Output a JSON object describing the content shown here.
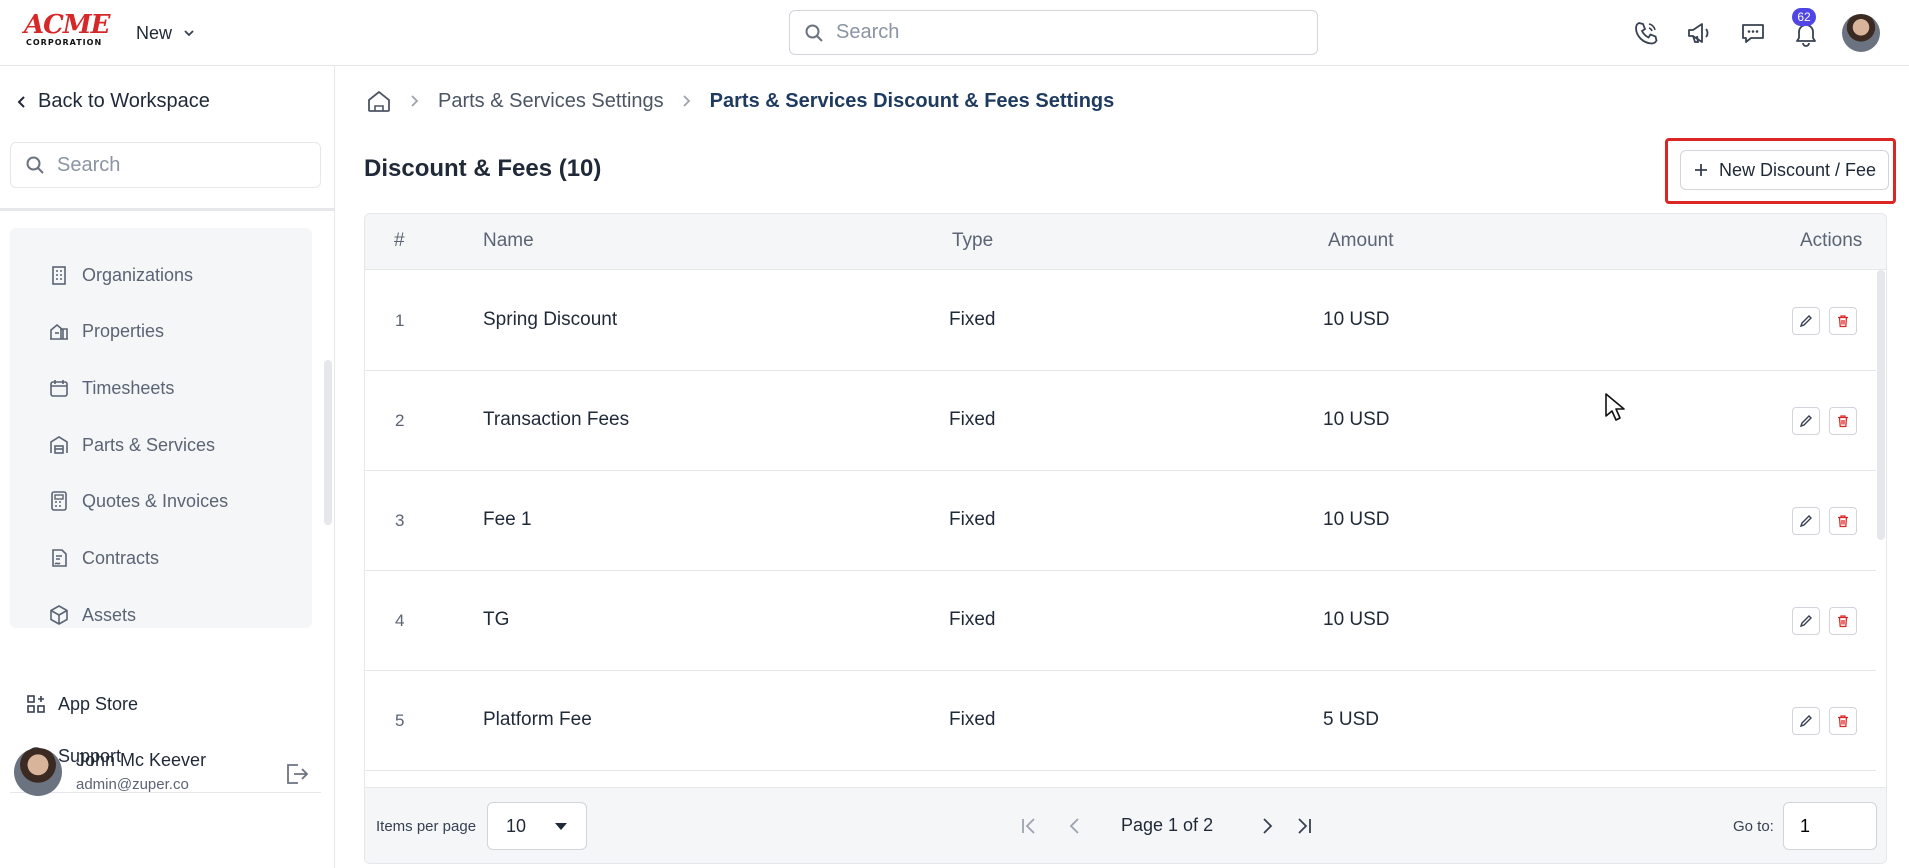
{
  "brand": {
    "logo_main": "ACME",
    "logo_sub": "CORPORATION",
    "logo_color": "#d62828"
  },
  "topbar": {
    "new_label": "New",
    "search_placeholder": "Search",
    "notification_count": "62",
    "icons": [
      "phone-icon",
      "megaphone-icon",
      "chat-icon",
      "bell-icon"
    ]
  },
  "sidebar": {
    "back_label": "Back to Workspace",
    "search_placeholder": "Search",
    "items": [
      {
        "label": "Organizations",
        "icon": "building-icon"
      },
      {
        "label": "Properties",
        "icon": "properties-icon"
      },
      {
        "label": "Timesheets",
        "icon": "calendar-icon"
      },
      {
        "label": "Parts & Services",
        "icon": "warehouse-icon"
      },
      {
        "label": "Quotes & Invoices",
        "icon": "calculator-icon"
      },
      {
        "label": "Contracts",
        "icon": "contract-icon"
      },
      {
        "label": "Assets",
        "icon": "box-icon"
      }
    ],
    "app_store_label": "App Store",
    "support_label": "Support",
    "user": {
      "name": "John Mc Keever",
      "email": "admin@zuper.co"
    }
  },
  "breadcrumb": {
    "items": [
      "Parts & Services Settings",
      "Parts & Services Discount & Fees Settings"
    ]
  },
  "page": {
    "title": "Discount & Fees (10)",
    "new_button_label": "New Discount / Fee",
    "highlight_color": "#dc2626"
  },
  "table": {
    "columns": [
      "#",
      "Name",
      "Type",
      "Amount",
      "Actions"
    ],
    "rows": [
      {
        "num": "1",
        "name": "Spring Discount",
        "type": "Fixed",
        "amount": "10 USD"
      },
      {
        "num": "2",
        "name": "Transaction Fees",
        "type": "Fixed",
        "amount": "10 USD"
      },
      {
        "num": "3",
        "name": "Fee 1",
        "type": "Fixed",
        "amount": "10 USD"
      },
      {
        "num": "4",
        "name": "TG",
        "type": "Fixed",
        "amount": "10 USD"
      },
      {
        "num": "5",
        "name": "Platform Fee",
        "type": "Fixed",
        "amount": "5 USD"
      }
    ]
  },
  "pagination": {
    "items_per_page_label": "Items per page",
    "items_per_page_value": "10",
    "page_text": "Page 1 of 2",
    "goto_label": "Go to:",
    "goto_value": "1"
  }
}
